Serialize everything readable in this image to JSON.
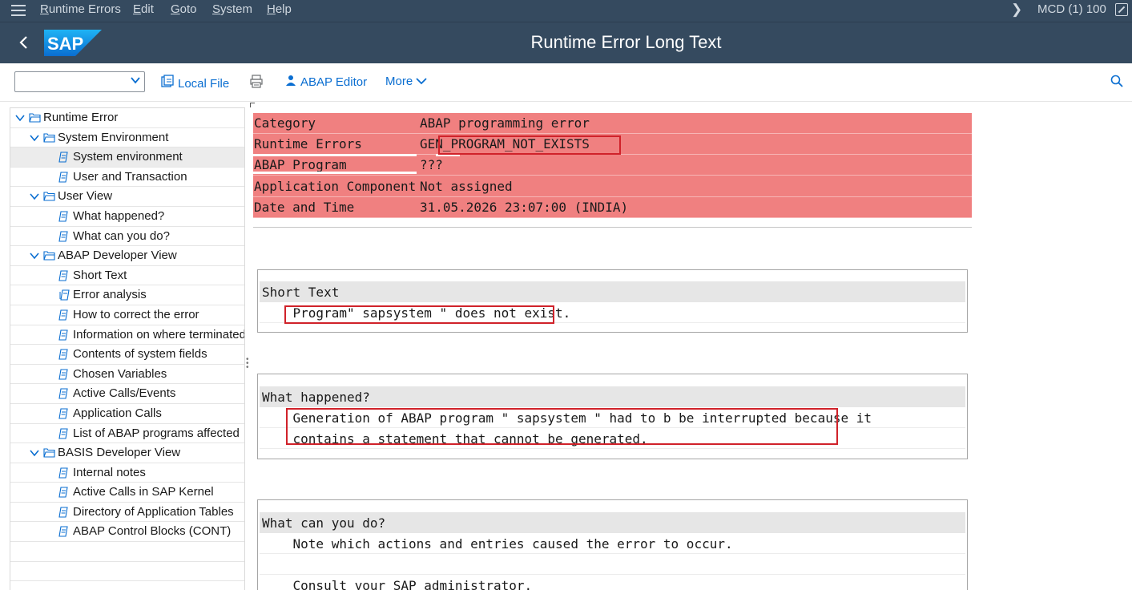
{
  "menubar": {
    "items": [
      {
        "label": "Runtime Errors",
        "underline_char": "R"
      },
      {
        "label": "Edit",
        "underline_char": "E"
      },
      {
        "label": "Goto",
        "underline_char": "G"
      },
      {
        "label": "System",
        "underline_char": "S"
      },
      {
        "label": "Help",
        "underline_char": "H"
      }
    ],
    "system_info": "MCD (1) 100"
  },
  "titlebar": {
    "logo_text": "SAP",
    "title": "Runtime Error Long Text"
  },
  "toolbar": {
    "dropdown_value": "",
    "local_file_label": "Local File",
    "abap_editor_label": "ABAP Editor",
    "more_label": "More"
  },
  "tree": {
    "items": [
      {
        "label": "Runtime Error",
        "level": 0,
        "expand": "open",
        "icon": "folder-open-icon"
      },
      {
        "label": "System Environment",
        "level": 1,
        "expand": "open",
        "icon": "folder-open-icon"
      },
      {
        "label": "System environment",
        "level": 2,
        "icon": "document-icon",
        "selected": true
      },
      {
        "label": "User and Transaction",
        "level": 2,
        "icon": "document-icon"
      },
      {
        "label": "User View",
        "level": 1,
        "expand": "open",
        "icon": "folder-open-icon"
      },
      {
        "label": "What happened?",
        "level": 2,
        "icon": "document-icon"
      },
      {
        "label": "What can you do?",
        "level": 2,
        "icon": "document-icon"
      },
      {
        "label": "ABAP Developer View",
        "level": 1,
        "expand": "open",
        "icon": "folder-open-icon"
      },
      {
        "label": "Short Text",
        "level": 2,
        "icon": "document-icon"
      },
      {
        "label": "Error analysis",
        "level": 2,
        "icon": "document-group-icon"
      },
      {
        "label": "How to correct the error",
        "level": 2,
        "icon": "document-icon"
      },
      {
        "label": "Information on where terminated",
        "level": 2,
        "icon": "document-icon"
      },
      {
        "label": "Contents of system fields",
        "level": 2,
        "icon": "document-icon"
      },
      {
        "label": "Chosen Variables",
        "level": 2,
        "icon": "document-icon"
      },
      {
        "label": "Active Calls/Events",
        "level": 2,
        "icon": "document-icon"
      },
      {
        "label": "Application Calls",
        "level": 2,
        "icon": "document-icon"
      },
      {
        "label": "List of ABAP programs affected",
        "level": 2,
        "icon": "document-icon"
      },
      {
        "label": "BASIS Developer View",
        "level": 1,
        "expand": "open",
        "icon": "folder-open-icon"
      },
      {
        "label": "Internal notes",
        "level": 2,
        "icon": "document-icon"
      },
      {
        "label": "Active Calls in SAP Kernel",
        "level": 2,
        "icon": "document-icon"
      },
      {
        "label": "Directory of Application Tables",
        "level": 2,
        "icon": "document-icon"
      },
      {
        "label": "ABAP Control Blocks (CONT)",
        "level": 2,
        "icon": "document-icon"
      }
    ]
  },
  "header_table": {
    "rows": [
      {
        "key": "Category",
        "value": "ABAP programming error"
      },
      {
        "key": "Runtime Errors",
        "value": "GEN_PROGRAM_NOT_EXISTS"
      },
      {
        "key": "ABAP Program",
        "value": "???"
      },
      {
        "key": "Application Component",
        "value": "Not assigned"
      },
      {
        "key": "Date and Time",
        "value": "31.05.2026 23:07:00 (INDIA)"
      }
    ],
    "highlight_color": "#f08080"
  },
  "sections": {
    "short_text": {
      "heading": "Short Text",
      "lines": [
        "    Program\" sapsystem \" does not exist."
      ]
    },
    "what_happened": {
      "heading": "What happened?",
      "lines": [
        "    Generation of ABAP program \" sapsystem \" had to b be interrupted because it",
        "    contains a statement that cannot be generated."
      ]
    },
    "what_can_you_do": {
      "heading": "What can you do?",
      "lines": [
        "    Note which actions and entries caused the error to occur.",
        "",
        "    Consult your SAP administrator."
      ]
    }
  },
  "colors": {
    "shell": "#354a5f",
    "accent": "#0a6ed1",
    "annotation_red": "#d0222a"
  }
}
